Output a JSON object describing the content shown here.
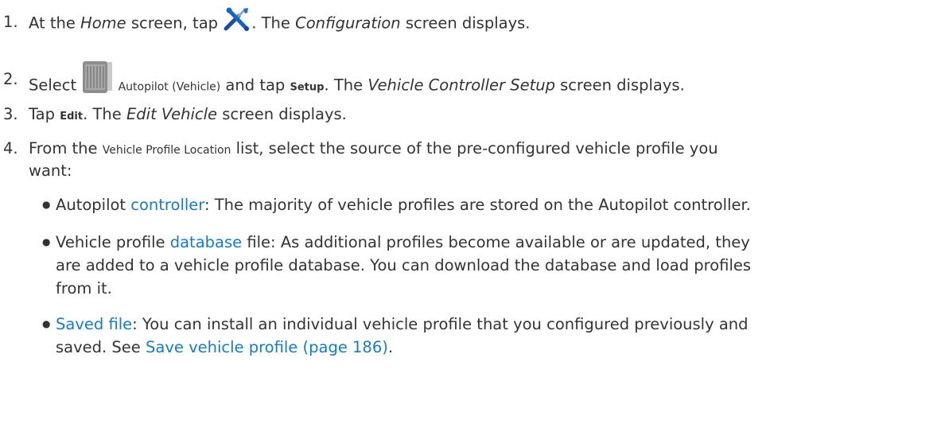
{
  "steps": [
    {
      "number": "1.",
      "t1": "At the ",
      "home_em": "Home",
      "t2": " screen, tap ",
      "icon": "wrench-screwdriver-icon",
      "t3": ". The ",
      "config_em": "Configuration",
      "t4": " screen displays."
    },
    {
      "number": "2.",
      "t1": "Select ",
      "icon": "autopilot-controller-icon",
      "autopilot_label": "Autopilot (Vehicle)",
      "t2": " and tap ",
      "setup_label": "Setup",
      "t3": ". The ",
      "vcs_em": "Vehicle Controller Setup",
      "t4": " screen displays."
    },
    {
      "number": "3.",
      "t1": "Tap ",
      "edit_label": "Edit",
      "t2": ". The ",
      "edit_vehicle_em": "Edit Vehicle",
      "t3": " screen displays."
    },
    {
      "number": "4.",
      "t1": "From the ",
      "list_label": "Vehicle Profile Location",
      "t2": " list, select the source of the pre-configured vehicle profile you",
      "t3": "want:"
    }
  ],
  "bullets": [
    {
      "pre": "Autopilot ",
      "link": "controller",
      "post": ": The majority of vehicle profiles are stored on the Autopilot controller."
    },
    {
      "pre": "Vehicle profile ",
      "link": "database",
      "post": " file: As additional profiles become available or are updated, they",
      "line2": "are added to a vehicle profile database. You can download the database and load profiles",
      "line3": "from it."
    },
    {
      "link": "Saved file",
      "post": ": You can install an individual vehicle profile that you configured previously and",
      "line2_pre": "saved. See ",
      "line2_link": "Save vehicle profile (page 186)",
      "line2_post": "."
    }
  ],
  "colors": {
    "text": "#333333",
    "link": "#1a7abf",
    "icon_blue": "#1565c0"
  }
}
